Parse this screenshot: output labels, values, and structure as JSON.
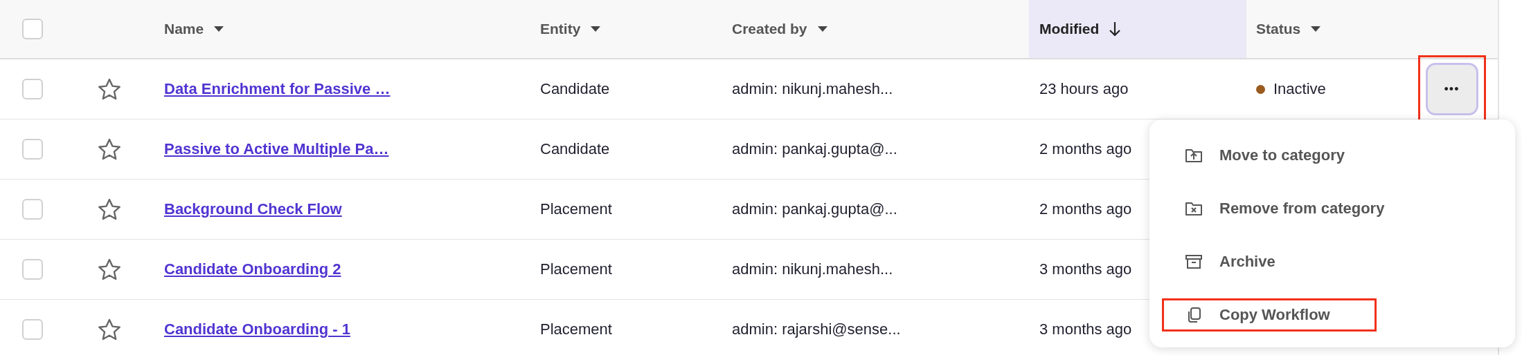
{
  "table": {
    "columns": [
      {
        "label": "Name",
        "kind": "filter",
        "sorted": false
      },
      {
        "label": "Entity",
        "kind": "filter",
        "sorted": false
      },
      {
        "label": "Created by",
        "kind": "filter",
        "sorted": false
      },
      {
        "label": "Modified",
        "kind": "sort",
        "sorted": true
      },
      {
        "label": "Status",
        "kind": "filter",
        "sorted": false
      }
    ],
    "header_checked": false,
    "rows": [
      {
        "checked": false,
        "starred": false,
        "name": "Data Enrichment for Passive …",
        "entity": "Candidate",
        "created_by": "admin: nikunj.mahesh...",
        "modified": "23 hours ago",
        "status": {
          "label": "Inactive",
          "color": "#9a5b1f"
        },
        "actions_button": {
          "label": "•••",
          "highlighted": true
        }
      },
      {
        "checked": false,
        "starred": false,
        "name": "Passive to Active Multiple Pa…",
        "entity": "Candidate",
        "created_by": "admin: pankaj.gupta@...",
        "modified": "2 months ago"
      },
      {
        "checked": false,
        "starred": false,
        "name": "Background Check Flow",
        "entity": "Placement",
        "created_by": "admin: pankaj.gupta@...",
        "modified": "2 months ago"
      },
      {
        "checked": false,
        "starred": false,
        "name": "Candidate Onboarding 2",
        "entity": "Placement",
        "created_by": "admin: nikunj.mahesh...",
        "modified": "3 months ago"
      },
      {
        "checked": false,
        "starred": false,
        "name": "Candidate Onboarding - 1",
        "entity": "Placement",
        "created_by": "admin: rajarshi@sense...",
        "modified": "3 months ago"
      }
    ]
  },
  "context_menu": {
    "items": [
      {
        "label": "Move to category",
        "kind": "move",
        "highlighted": false
      },
      {
        "label": "Remove from category",
        "kind": "remove",
        "highlighted": false
      },
      {
        "label": "Archive",
        "kind": "archive",
        "highlighted": false
      },
      {
        "label": "Copy Workflow",
        "kind": "copy",
        "highlighted": true
      }
    ]
  }
}
